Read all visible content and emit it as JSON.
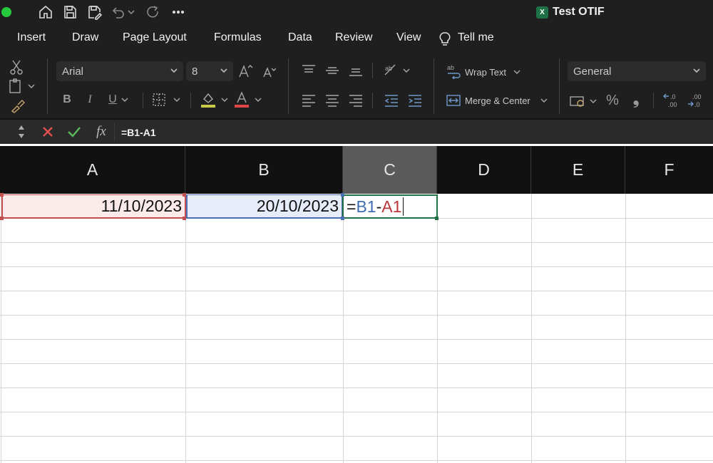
{
  "window": {
    "title": "Test OTIF",
    "app_icon": "excel-icon"
  },
  "quick_access": [
    "home-icon",
    "save-icon",
    "save-as-icon",
    "undo-icon",
    "undo-dropdown-icon",
    "redo-icon",
    "more-icon"
  ],
  "menu_tabs": [
    "Insert",
    "Draw",
    "Page Layout",
    "Formulas",
    "Data",
    "Review",
    "View",
    "Tell me"
  ],
  "ribbon": {
    "font_name": "Arial",
    "font_size": "8",
    "wrap_text_label": "Wrap Text",
    "merge_center_label": "Merge & Center",
    "number_format": "General",
    "percent_symbol": "%",
    "comma_symbol": "❟",
    "bold": "B",
    "italic": "I",
    "underline": "U",
    "font_color_bar": "#e04646",
    "highlight_color_bar": "#c8c84a"
  },
  "formula_bar": {
    "fx_label": "fx",
    "content": "=B1-A1"
  },
  "columns": [
    "A",
    "B",
    "C",
    "D",
    "E",
    "F"
  ],
  "active_column": "C",
  "cells": {
    "A1": "11/10/2023",
    "B1": "20/10/2023",
    "C1": {
      "eq": "=",
      "ref1": "B1",
      "op": "-",
      "ref2": "A1"
    }
  },
  "colors": {
    "ref_b_color": "#3f6db3",
    "ref_a_color": "#b8373a",
    "selection_border": "#217346",
    "traffic_light": "#27c93f"
  }
}
